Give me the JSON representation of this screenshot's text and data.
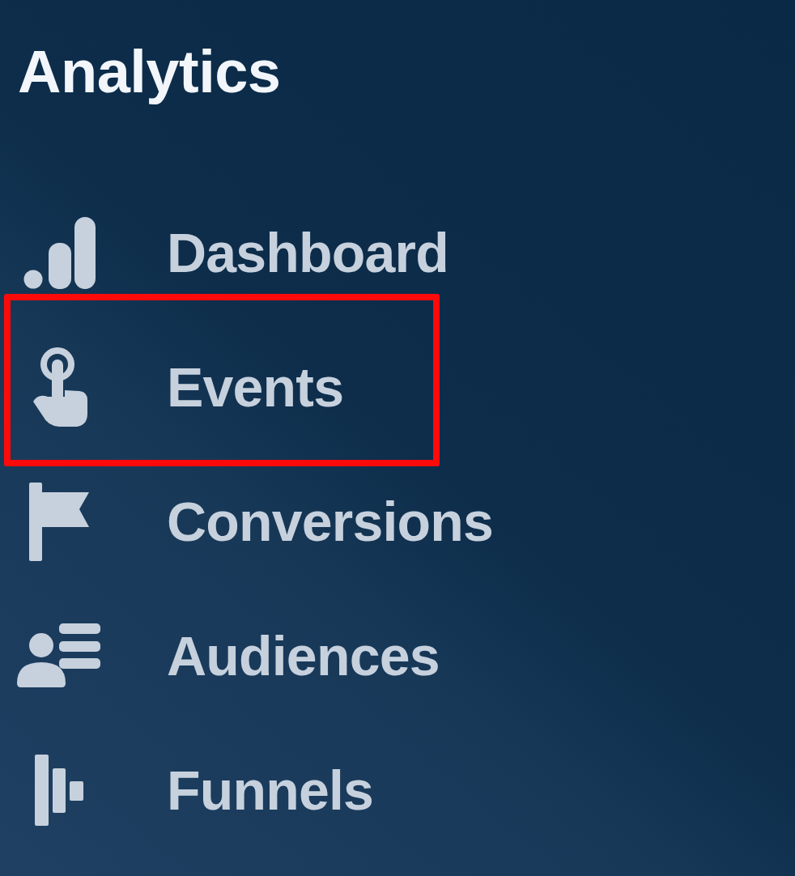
{
  "title": "Analytics",
  "items": [
    {
      "label": "Dashboard",
      "highlighted": false
    },
    {
      "label": "Events",
      "highlighted": true
    },
    {
      "label": "Conversions",
      "highlighted": false
    },
    {
      "label": "Audiences",
      "highlighted": false
    },
    {
      "label": "Funnels",
      "highlighted": false
    }
  ]
}
